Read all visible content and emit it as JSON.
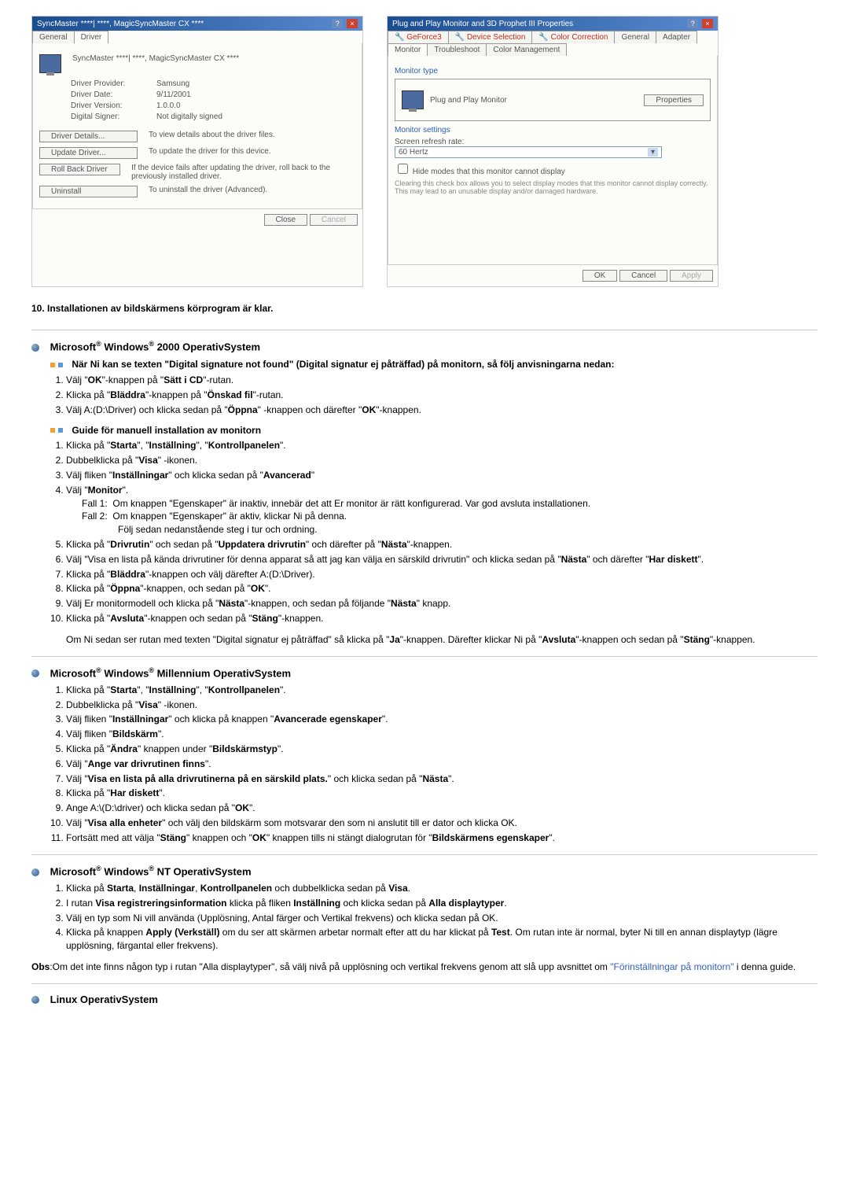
{
  "dialog1": {
    "title": "SyncMaster ****| ****, MagicSyncMaster CX ****",
    "tabs": {
      "general": "General",
      "driver": "Driver"
    },
    "device_name": "SyncMaster ****| ****, MagicSyncMaster CX ****",
    "info": {
      "provider_label": "Driver Provider:",
      "provider_value": "Samsung",
      "date_label": "Driver Date:",
      "date_value": "9/11/2001",
      "version_label": "Driver Version:",
      "version_value": "1.0.0.0",
      "signer_label": "Digital Signer:",
      "signer_value": "Not digitally signed"
    },
    "buttons": {
      "details": "Driver Details...",
      "details_desc": "To view details about the driver files.",
      "update": "Update Driver...",
      "update_desc": "To update the driver for this device.",
      "rollback": "Roll Back Driver",
      "rollback_desc": "If the device fails after updating the driver, roll back to the previously installed driver.",
      "uninstall": "Uninstall",
      "uninstall_desc": "To uninstall the driver (Advanced).",
      "close": "Close",
      "cancel": "Cancel"
    }
  },
  "dialog2": {
    "title": "Plug and Play Monitor and 3D Prophet III Properties",
    "tabs": {
      "geforce": "GeForce3",
      "device": "Device Selection",
      "color": "Color Correction",
      "general": "General",
      "adapter": "Adapter",
      "monitor": "Monitor",
      "troubleshoot": "Troubleshoot",
      "colormgmt": "Color Management"
    },
    "monitor_type_label": "Monitor type",
    "monitor_name": "Plug and Play Monitor",
    "properties": "Properties",
    "settings_label": "Monitor settings",
    "refresh_label": "Screen refresh rate:",
    "refresh_value": "60 Hertz",
    "hide_modes": "Hide modes that this monitor cannot display",
    "hide_desc": "Clearing this check box allows you to select display modes that this monitor cannot display correctly. This may lead to an unusable display and/or damaged hardware.",
    "ok": "OK",
    "cancel": "Cancel",
    "apply": "Apply"
  },
  "step10": "10.   Installationen av bildskärmens körprogram är klar.",
  "sec_2000": {
    "heading_pre": "Microsoft",
    "heading_mid": " Windows",
    "heading_post": " 2000 OperativSystem",
    "sub1": "När Ni kan se texten \"Digital signature not found\" (Digital signatur ej påträffad) på monitorn, så följ anvisningarna nedan:",
    "s1_1_a": "Välj \"",
    "s1_1_b": "OK",
    "s1_1_c": "\"-knappen på \"",
    "s1_1_d": "Sätt i CD",
    "s1_1_e": "\"-rutan.",
    "s1_2_a": "Klicka på \"",
    "s1_2_b": "Bläddra",
    "s1_2_c": "\"-knappen på \"",
    "s1_2_d": "Önskad fil",
    "s1_2_e": "\"-rutan.",
    "s1_3_a": "Välj A:(D:\\Driver) och klicka sedan på \"",
    "s1_3_b": "Öppna",
    "s1_3_c": "\" -knappen och därefter \"",
    "s1_3_d": "OK",
    "s1_3_e": "\"-knappen.",
    "sub2": "Guide för manuell installation av monitorn",
    "m1_a": "Klicka på \"",
    "m1_b": "Starta",
    "m1_c": "\", \"",
    "m1_d": "Inställning",
    "m1_e": "\", \"",
    "m1_f": "Kontrollpanelen",
    "m1_g": "\".",
    "m2_a": "Dubbelklicka på \"",
    "m2_b": "Visa",
    "m2_c": "\" -ikonen.",
    "m3_a": "Välj fliken \"",
    "m3_b": "Inställningar",
    "m3_c": "\" och klicka sedan på \"",
    "m3_d": "Avancerad",
    "m3_e": "\"",
    "m4_a": "Välj \"",
    "m4_b": "Monitor",
    "m4_c": "\".",
    "m4_f1l": "Fall 1:",
    "m4_f1t": "Om knappen \"Egenskaper\" är inaktiv, innebär det att Er monitor är rätt konfigurerad. Var god avsluta installationen.",
    "m4_f2l": "Fall 2:",
    "m4_f2t": "Om knappen \"Egenskaper\" är aktiv, klickar Ni på denna.",
    "m4_f2t2": "Följ sedan nedanstående steg i tur och ordning.",
    "m5_a": "Klicka på \"",
    "m5_b": "Drivrutin",
    "m5_c": "\" och sedan på \"",
    "m5_d": "Uppdatera drivrutin",
    "m5_e": "\" och därefter på \"",
    "m5_f": "Nästa",
    "m5_g": "\"-knappen.",
    "m6_a": "Välj \"Visa en lista på kända drivrutiner för denna apparat så att jag kan välja en särskild drivrutin\" och klicka sedan på \"",
    "m6_b": "Nästa",
    "m6_c": "\" och därefter \"",
    "m6_d": "Har diskett",
    "m6_e": "\".",
    "m7_a": "Klicka på \"",
    "m7_b": "Bläddra",
    "m7_c": "\"-knappen och välj därefter A:(D:\\Driver).",
    "m8_a": "Klicka på \"",
    "m8_b": "Öppna",
    "m8_c": "\"-knappen, och sedan på \"",
    "m8_d": "OK",
    "m8_e": "\".",
    "m9_a": "Välj Er monitormodell och klicka på \"",
    "m9_b": "Nästa",
    "m9_c": "\"-knappen, och sedan på följande \"",
    "m9_d": "Nästa",
    "m9_e": "\" knapp.",
    "m10_a": "Klicka på \"",
    "m10_b": "Avsluta",
    "m10_c": "\"-knappen och sedan på \"",
    "m10_d": "Stäng",
    "m10_e": "\"-knappen.",
    "note_a": "Om Ni sedan ser rutan med texten \"Digital signatur ej påträffad\" så klicka på \"",
    "note_b": "Ja",
    "note_c": "\"-knappen. Därefter klickar Ni på \"",
    "note_d": "Avsluta",
    "note_e": "\"-knappen och sedan på \"",
    "note_f": "Stäng",
    "note_g": "\"-knappen."
  },
  "sec_me": {
    "heading_post": " Millennium OperativSystem",
    "i1_a": "Klicka på \"",
    "i1_b": "Starta",
    "i1_c": "\", \"",
    "i1_d": "Inställning",
    "i1_e": "\", \"",
    "i1_f": "Kontrollpanelen",
    "i1_g": "\".",
    "i2_a": "Dubbelklicka på \"",
    "i2_b": "Visa",
    "i2_c": "\" -ikonen.",
    "i3_a": "Välj fliken \"",
    "i3_b": "Inställningar",
    "i3_c": "\" och klicka på knappen \"",
    "i3_d": "Avancerade egenskaper",
    "i3_e": "\".",
    "i4_a": "Välj fliken \"",
    "i4_b": "Bildskärm",
    "i4_c": "\".",
    "i5_a": "Klicka på \"",
    "i5_b": "Ändra",
    "i5_c": "\" knappen under \"",
    "i5_d": "Bildskärmstyp",
    "i5_e": "\".",
    "i6_a": "Välj \"",
    "i6_b": "Ange var drivrutinen finns",
    "i6_c": "\".",
    "i7_a": "Välj \"",
    "i7_b": "Visa en lista på alla drivrutinerna på en särskild plats.",
    "i7_c": "\" och klicka sedan på \"",
    "i7_d": "Nästa",
    "i7_e": "\".",
    "i8_a": "Klicka på \"",
    "i8_b": "Har diskett",
    "i8_c": "\".",
    "i9_a": "Ange A:\\(D:\\driver) och klicka sedan på \"",
    "i9_b": "OK",
    "i9_c": "\".",
    "i10_a": "Välj \"",
    "i10_b": "Visa alla enheter",
    "i10_c": "\" och välj den bildskärm som motsvarar den som ni anslutit till er dator och klicka OK.",
    "i11_a": "Fortsätt med att välja \"",
    "i11_b": "Stäng",
    "i11_c": "\" knappen och \"",
    "i11_d": "OK",
    "i11_e": "\" knappen tills ni stängt dialogrutan för \"",
    "i11_f": "Bildskärmens egenskaper",
    "i11_g": "\"."
  },
  "sec_nt": {
    "heading_post": " NT OperativSystem",
    "n1_a": "Klicka på ",
    "n1_b": "Starta",
    "n1_c": ", ",
    "n1_d": "Inställningar",
    "n1_e": ", ",
    "n1_f": "Kontrollpanelen",
    "n1_g": " och dubbelklicka sedan på ",
    "n1_h": "Visa",
    "n1_i": ".",
    "n2_a": "I rutan ",
    "n2_b": "Visa registreringsinformation",
    "n2_c": " klicka på fliken ",
    "n2_d": "Inställning",
    "n2_e": " och klicka sedan på ",
    "n2_f": "Alla displaytyper",
    "n2_g": ".",
    "n3": "Välj en typ som Ni vill använda (Upplösning, Antal färger och Vertikal frekvens) och klicka sedan på OK.",
    "n4_a": "Klicka på knappen ",
    "n4_b": "Apply (Verkställ)",
    "n4_c": " om du ser att skärmen arbetar normalt efter att du har klickat på ",
    "n4_d": "Test",
    "n4_e": ". Om rutan inte är normal, byter Ni till en annan displaytyp (lägre upplösning, färgantal eller frekvens).",
    "obs_a": "Obs",
    "obs_b": ":Om det inte finns någon typ i rutan \"Alla displaytyper\", så välj nivå på upplösning och vertikal frekvens genom att slå upp avsnittet om ",
    "obs_link": "\"Förinställningar på monitorn\"",
    "obs_c": " i denna guide."
  },
  "sec_linux": {
    "heading": "Linux OperativSystem"
  }
}
